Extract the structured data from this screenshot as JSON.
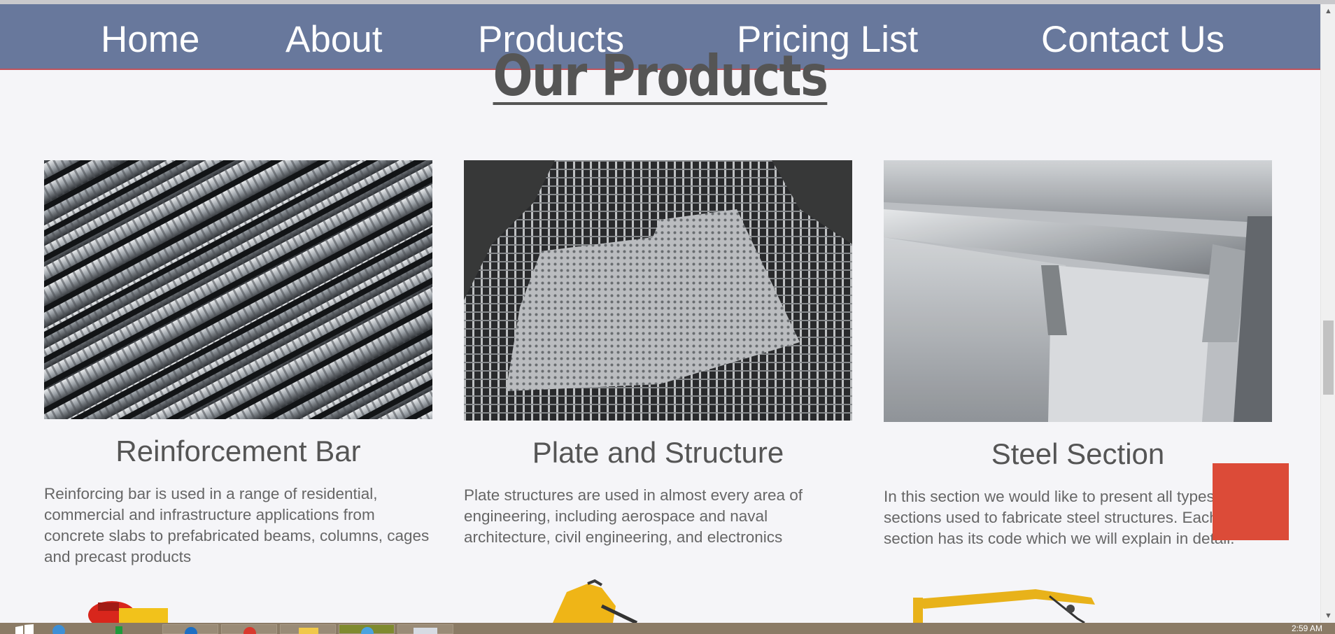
{
  "nav": {
    "items": [
      {
        "label": "Home"
      },
      {
        "label": "About"
      },
      {
        "label": "Products"
      },
      {
        "label": "Pricing List"
      },
      {
        "label": "Contact Us"
      }
    ]
  },
  "page": {
    "title": "Our Products"
  },
  "products": [
    {
      "title": "Reinforcement Bar",
      "description": "Reinforcing bar is used in a range of residential, commercial and infrastructure applications from concrete slabs to prefabricated beams, columns, cages and precast products"
    },
    {
      "title": "Plate and Structure",
      "description": "Plate structures are used in almost every area of engineering, including aerospace and naval architecture, civil engineering, and electronics"
    },
    {
      "title": "Steel Section",
      "description": "In this section we would like to present all types of steel sections used to fabricate steel structures. Each section has its code which we will explain in detail."
    }
  ],
  "taskbar": {
    "clock": "2:59 AM"
  },
  "colors": {
    "nav_bg": "#68789c",
    "nav_border": "#c0535c",
    "page_bg": "#f5f5f8",
    "accent_red": "#dc4b38",
    "text": "#555555"
  }
}
